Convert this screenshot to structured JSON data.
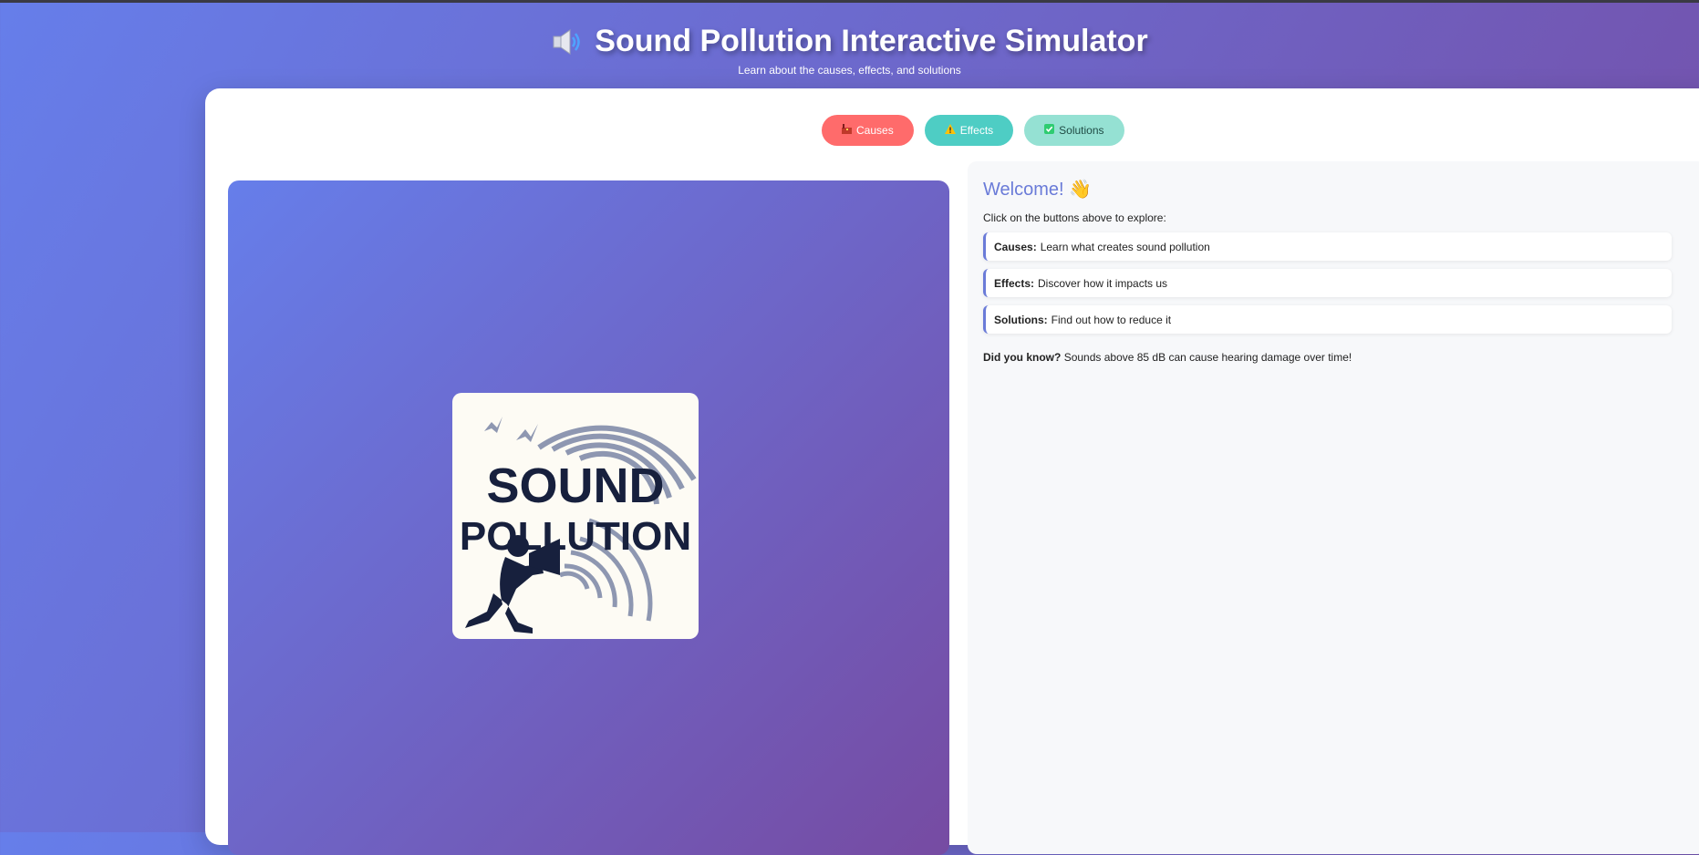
{
  "header": {
    "title": "Sound Pollution Interactive Simulator",
    "subtitle": "Learn about the causes, effects, and solutions",
    "title_icon": "speaker-icon"
  },
  "tabs": [
    {
      "label": "Causes",
      "icon": "factory-icon",
      "color": "#ff6b6b"
    },
    {
      "label": "Effects",
      "icon": "warning-icon",
      "color": "#4ecdc4"
    },
    {
      "label": "Solutions",
      "icon": "check-box-icon",
      "color": "#95e1d3"
    }
  ],
  "logo": {
    "line1": "SOUND",
    "line2": "POLLUTION"
  },
  "panel": {
    "welcome": "Welcome! 👋",
    "intro": "Click on the buttons above to explore:",
    "items": [
      {
        "term": "Causes:",
        "desc": "Learn what creates sound pollution"
      },
      {
        "term": "Effects:",
        "desc": "Discover how it impacts us"
      },
      {
        "term": "Solutions:",
        "desc": "Find out how to reduce it"
      }
    ],
    "fact_term": "Did you know?",
    "fact_text": "Sounds above 85 dB can cause hearing damage over time!"
  },
  "colors": {
    "accent": "#6a7bd8",
    "gradient_start": "#667eea",
    "gradient_end": "#764ba2"
  }
}
